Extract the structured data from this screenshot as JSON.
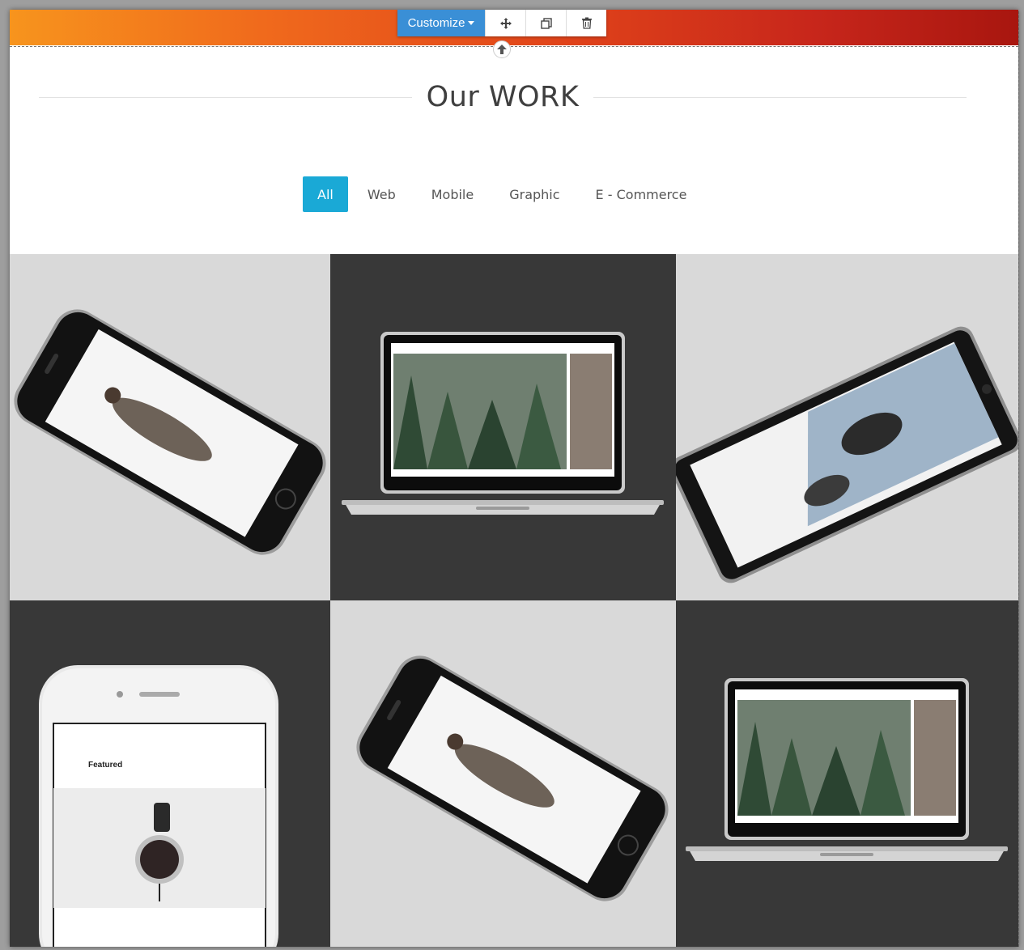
{
  "toolbar": {
    "customize_label": "Customize",
    "move_icon": "move-arrows-icon",
    "duplicate_icon": "duplicate-icon",
    "delete_icon": "trash-icon",
    "up_icon": "arrow-up-icon"
  },
  "section": {
    "title": "Our WORK",
    "accent_color": "#1aa9d6"
  },
  "filters": [
    {
      "label": "All",
      "active": true
    },
    {
      "label": "Web",
      "active": false
    },
    {
      "label": "Mobile",
      "active": false
    },
    {
      "label": "Graphic",
      "active": false
    },
    {
      "label": "E - Commerce",
      "active": false
    }
  ],
  "portfolio": {
    "items": [
      {
        "device": "phone-landscape",
        "theme": "light"
      },
      {
        "device": "laptop",
        "theme": "dark"
      },
      {
        "device": "tablet",
        "theme": "light"
      },
      {
        "device": "phone-portrait",
        "theme": "dark"
      },
      {
        "device": "phone-landscape",
        "theme": "light"
      },
      {
        "device": "laptop",
        "theme": "dark"
      }
    ],
    "phone_featured_text": "Featured"
  }
}
